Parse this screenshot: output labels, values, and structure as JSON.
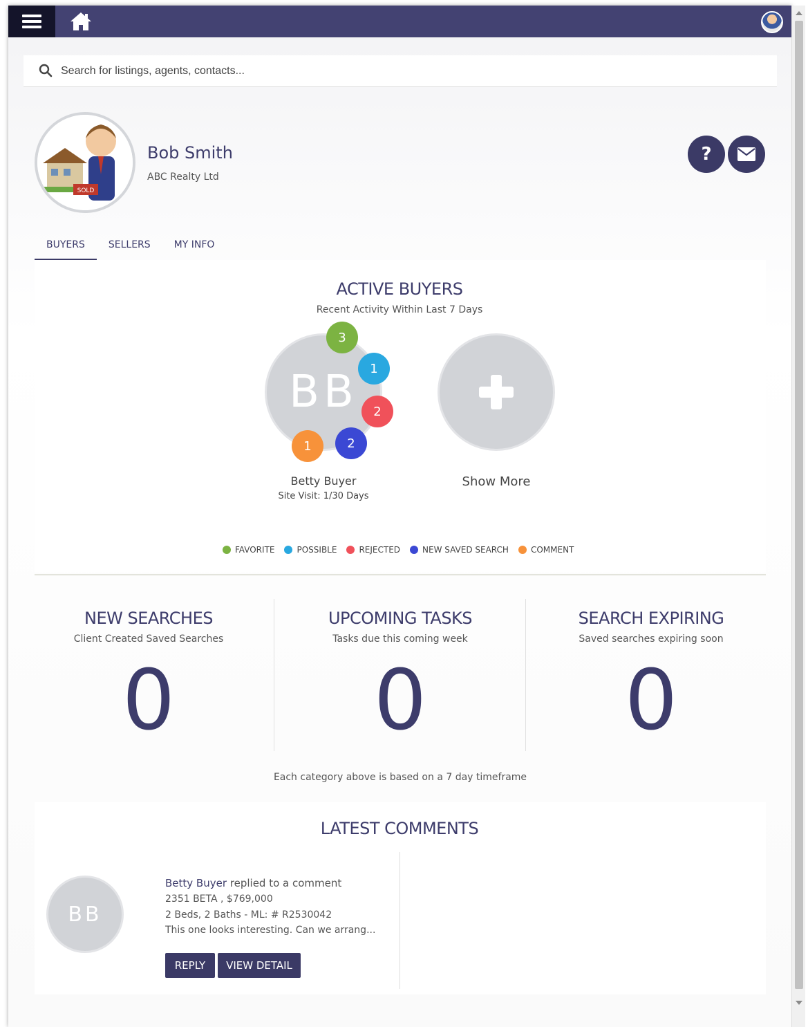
{
  "search": {
    "placeholder": "Search for listings, agents, contacts..."
  },
  "profile": {
    "name": "Bob Smith",
    "company": "ABC Realty Ltd",
    "help_label": "?"
  },
  "tabs": [
    {
      "label": "BUYERS",
      "active": true
    },
    {
      "label": "SELLERS",
      "active": false
    },
    {
      "label": "MY INFO",
      "active": false
    }
  ],
  "active_buyers": {
    "title": "ACTIVE BUYERS",
    "subtitle": "Recent Activity Within Last 7 Days",
    "buyer": {
      "initials": "BB",
      "name": "Betty Buyer",
      "site_visit": "Site Visit: 1/30 Days",
      "counts": {
        "favorite": "3",
        "possible": "1",
        "rejected": "2",
        "new_saved_search": "2",
        "comment": "1"
      }
    },
    "show_more": "Show More"
  },
  "legend": [
    {
      "label": "FAVORITE",
      "color": "#7cb342"
    },
    {
      "label": "POSSIBLE",
      "color": "#29a8e0"
    },
    {
      "label": "REJECTED",
      "color": "#f0515a"
    },
    {
      "label": "NEW SAVED SEARCH",
      "color": "#3b48d4"
    },
    {
      "label": "COMMENT",
      "color": "#f7923a"
    }
  ],
  "stats": [
    {
      "title": "NEW SEARCHES",
      "subtitle": "Client Created Saved Searches",
      "value": "0"
    },
    {
      "title": "UPCOMING TASKS",
      "subtitle": "Tasks due this coming week",
      "value": "0"
    },
    {
      "title": "SEARCH EXPIRING",
      "subtitle": "Saved searches expiring soon",
      "value": "0"
    }
  ],
  "timeframe_note": "Each category above is based on a 7 day timeframe",
  "comments": {
    "title": "LATEST COMMENTS",
    "item": {
      "initials": "BB",
      "who": "Betty Buyer",
      "action": " replied to a comment",
      "address": "2351 BETA ,  $769,000",
      "details": "2 Beds, 2 Baths - ML: # R2530042",
      "excerpt": "This one looks interesting. Can we arrang...",
      "reply_label": "REPLY",
      "view_label": "VIEW DETAIL"
    }
  }
}
